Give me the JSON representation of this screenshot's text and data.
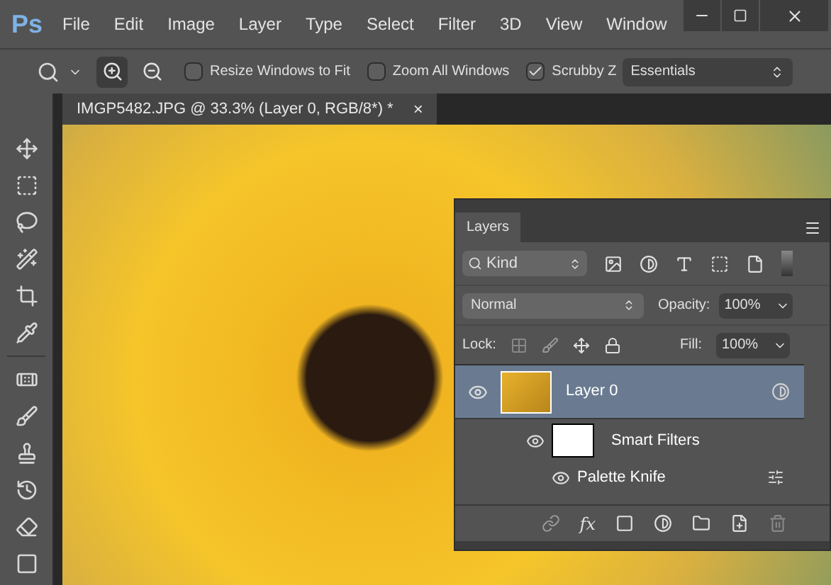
{
  "app": {
    "logo": "Ps",
    "menu": [
      "File",
      "Edit",
      "Image",
      "Layer",
      "Type",
      "Select",
      "Filter",
      "3D",
      "View",
      "Window"
    ]
  },
  "options_bar": {
    "checkboxes": [
      {
        "label": "Resize Windows to Fit",
        "checked": false
      },
      {
        "label": "Zoom All Windows",
        "checked": false
      },
      {
        "label": "Scrubby Z",
        "checked": true
      }
    ],
    "workspace": "Essentials"
  },
  "document_tab": {
    "title": "IMGP5482.JPG @ 33.3% (Layer 0, RGB/8*) *",
    "close": "×"
  },
  "layers_panel": {
    "tab": "Layers",
    "filter": "Kind",
    "blend_mode": "Normal",
    "opacity_label": "Opacity:",
    "opacity": "100%",
    "lock_label": "Lock:",
    "fill_label": "Fill:",
    "fill": "100%",
    "fx": "fx",
    "layers": [
      {
        "name": "Layer 0",
        "visible": true,
        "selected": true,
        "children": [
          {
            "name": "Smart Filters",
            "visible": true,
            "selected": false,
            "children": [
              {
                "name": "Palette Knife",
                "visible": true,
                "selected": false
              }
            ]
          }
        ]
      }
    ]
  }
}
